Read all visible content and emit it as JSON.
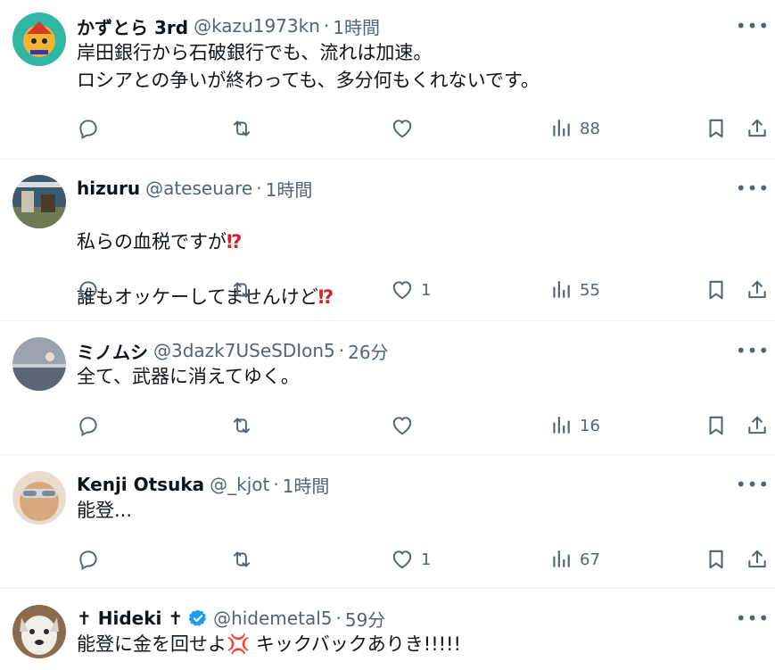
{
  "tweets": [
    {
      "name": "かずとら 3rd",
      "handle": "@kazu1973kn",
      "sep": "·",
      "time": "1時間",
      "text": "岸田銀行から石破銀行でも、流れは加速。\nロシアとの争いが終わっても、多分何もくれないです。",
      "likes": "",
      "views": "88",
      "avatar_color": "#2fb7a3"
    },
    {
      "name": "hizuru",
      "handle": "@ateseuare",
      "sep": "·",
      "time": "1時間",
      "text_line1": "私らの血税ですが",
      "text_line2": "誰もオッケーしてませんけど",
      "emoji": "⁉",
      "likes": "1",
      "views": "55",
      "avatar_color": "#3d5a6e"
    },
    {
      "name": "ミノムシ",
      "handle": "@3dazk7USeSDIon5",
      "sep": "·",
      "time": "26分",
      "text": "全て、武器に消えてゆく。",
      "likes": "",
      "views": "16",
      "avatar_color": "#7f8a99"
    },
    {
      "name": "Kenji Otsuka",
      "handle": "@_kjot",
      "sep": "·",
      "time": "1時間",
      "text": "能登...",
      "likes": "1",
      "views": "67",
      "avatar_color": "#c9a07a"
    },
    {
      "name": "✝ Hideki ✝",
      "handle": "@hidemetal5",
      "sep": "·",
      "time": "59分",
      "text_before": "能登に金を回せよ",
      "anger_emoji": "💢",
      "text_after": " キックバックありき!!!!!",
      "verified": true,
      "avatar_color": "#8c6b4f"
    }
  ],
  "colors": {
    "text": "#0f1419",
    "secondary": "#536471",
    "verified": "#1d9bf0",
    "divider": "#eff3f4"
  },
  "icons": [
    "reply-icon",
    "retweet-icon",
    "like-icon",
    "views-icon",
    "bookmark-icon",
    "share-icon",
    "more-icon",
    "verified-icon"
  ]
}
